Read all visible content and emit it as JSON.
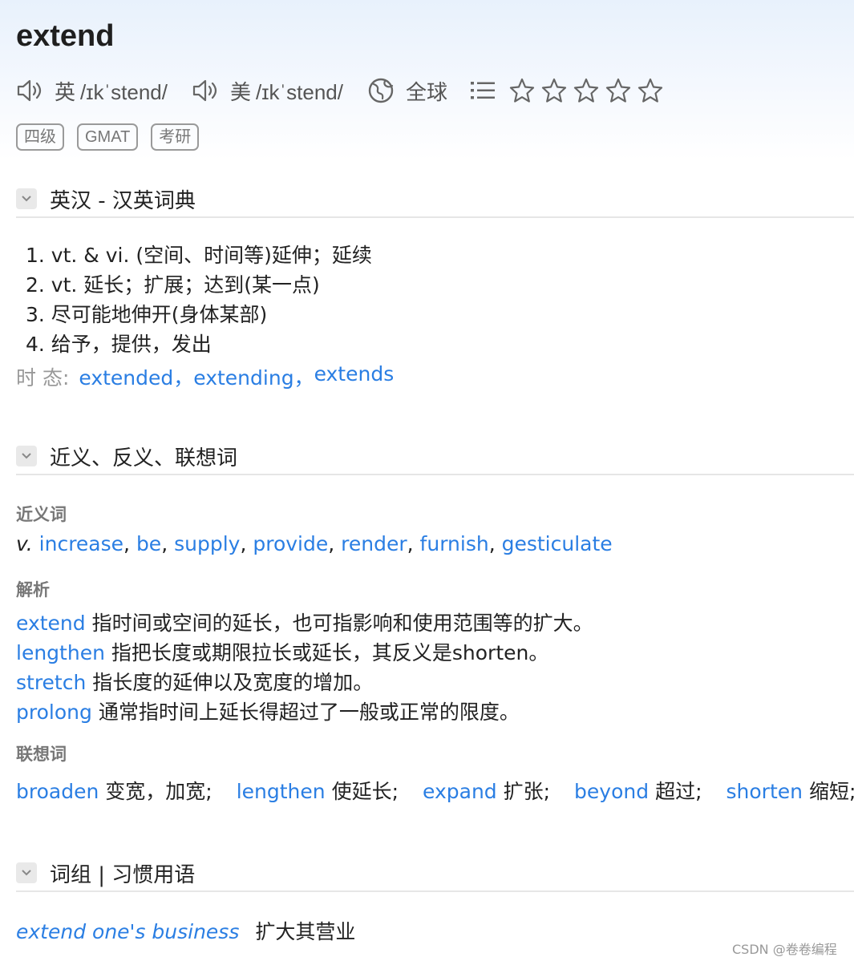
{
  "word": "extend",
  "pron": {
    "uk_region": "英",
    "uk_ipa": "/ɪkˈstend/",
    "us_region": "美",
    "us_ipa": "/ɪkˈstend/",
    "global_label": "全球"
  },
  "rating": {
    "stars": 5,
    "filled": 0
  },
  "tags": [
    "四级",
    "GMAT",
    "考研"
  ],
  "sections": {
    "dict_title": "英汉 - 汉英词典",
    "related_title": "近义、反义、联想词",
    "phrase_title": "词组 | 习惯用语"
  },
  "definitions": [
    "1. vt. & vi. (空间、时间等)延伸；延续",
    "2. vt. 延长；扩展；达到(某一点)",
    "3. 尽可能地伸开(身体某部)",
    "4. 给予，提供，发出"
  ],
  "tense": {
    "label": "时 态:",
    "forms": [
      "extended，",
      "extending，",
      "extends"
    ]
  },
  "synonyms": {
    "label": "近义词",
    "pos": "v.",
    "words": [
      "increase",
      "be",
      "supply",
      "provide",
      "render",
      "furnish",
      "gesticulate"
    ]
  },
  "analysis": {
    "label": "解析",
    "items": [
      {
        "word": "extend",
        "text": "指时间或空间的延长，也可指影响和使用范围等的扩大。"
      },
      {
        "word": "lengthen",
        "text": "指把长度或期限拉长或延长，其反义是shorten。"
      },
      {
        "word": "stretch",
        "text": "指长度的延伸以及宽度的增加。"
      },
      {
        "word": "prolong",
        "text": "通常指时间上延长得超过了一般或正常的限度。"
      }
    ]
  },
  "association": {
    "label": "联想词",
    "items": [
      {
        "word": "broaden",
        "meaning": "变宽，加宽;"
      },
      {
        "word": "lengthen",
        "meaning": "使延长;"
      },
      {
        "word": "expand",
        "meaning": "扩张;"
      },
      {
        "word": "beyond",
        "meaning": "超过;"
      },
      {
        "word": "shorten",
        "meaning": "缩短;"
      }
    ]
  },
  "phrases": [
    {
      "phrase": "extend one's business",
      "meaning": "扩大其营业"
    }
  ],
  "watermark": "CSDN @卷卷编程",
  "colors": {
    "link": "#2a7ee3",
    "muted": "#999999",
    "header_bg": "#e8f1fc"
  }
}
